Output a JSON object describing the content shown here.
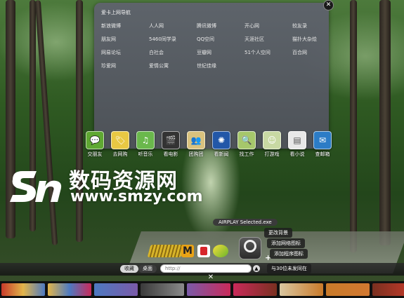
{
  "nav_panel": {
    "title": "爱卡上网导航",
    "links": [
      "新浪微博",
      "人人网",
      "腾讯微博",
      "开心网",
      "较友录",
      "朋友网",
      "5460同学录",
      "QQ空间",
      "天涯社区",
      "猫扑大杂烩",
      "网易论坛",
      "白社会",
      "豆瓣网",
      "51个人空间",
      "百合网",
      "珍爱网",
      "爱情公寓",
      "世纪佳缘"
    ]
  },
  "dock_apps": [
    {
      "label": "交朋友",
      "icon": "chat-icon",
      "color": "#5fa832"
    },
    {
      "label": "去网购",
      "icon": "shopping-icon",
      "color": "#e9c843"
    },
    {
      "label": "听音乐",
      "icon": "music-icon",
      "color": "#6ab84c"
    },
    {
      "label": "看电影",
      "icon": "film-icon",
      "color": "#333333"
    },
    {
      "label": "团购团",
      "icon": "group-icon",
      "color": "#d9c27e"
    },
    {
      "label": "看新闻",
      "icon": "news-icon",
      "color": "#2257a8"
    },
    {
      "label": "找工作",
      "icon": "search-job-icon",
      "color": "#a6c76b"
    },
    {
      "label": "打游戏",
      "icon": "game-icon",
      "color": "#c8d9a3"
    },
    {
      "label": "看小说",
      "icon": "book-icon",
      "color": "#e8e8e8"
    },
    {
      "label": "查邮箱",
      "icon": "mail-icon",
      "color": "#2c7cc6"
    }
  ],
  "watermark": {
    "text": "数码资源网",
    "url": "www.smzy.com"
  },
  "airplay_label": "AIRPLAY Selected.exe",
  "context_menu": [
    "更改背景",
    "添加网络图标",
    "添加程序图标",
    "与30位未发同在"
  ],
  "bottom_bar": {
    "favorites_label": "收藏",
    "desktop_label": "桌面",
    "url_placeholder": "http://",
    "up_symbol": "▲",
    "close_symbol": "✕"
  },
  "close_symbol": "✕",
  "thumbnails": [
    "#c83a2a",
    "#e2b54a",
    "#4d79c1",
    "#d27830",
    "#7a5aa8",
    "#c92a5a",
    "#d9c6a0",
    "#c97a2a",
    "#7a3020"
  ]
}
